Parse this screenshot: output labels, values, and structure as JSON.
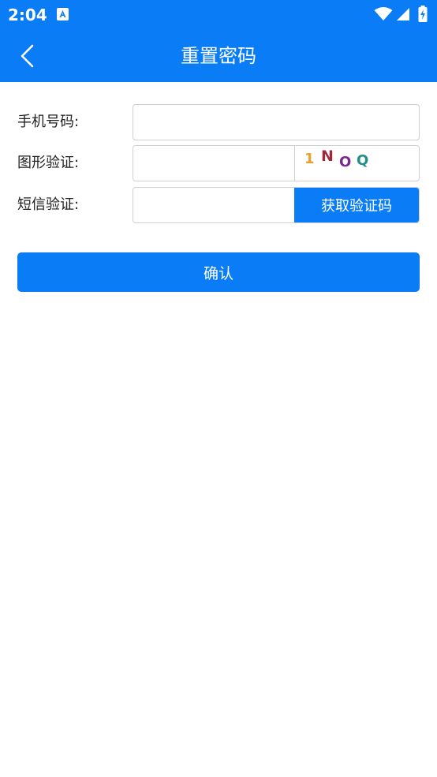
{
  "status_bar": {
    "time": "2:04",
    "icons": [
      "app-notification-icon",
      "wifi-icon",
      "signal-icon",
      "battery-icon"
    ]
  },
  "header": {
    "title": "重置密码",
    "back_icon": "chevron-left-icon"
  },
  "form": {
    "phone": {
      "label": "手机号码:",
      "value": "",
      "placeholder": ""
    },
    "captcha": {
      "label": "图形验证:",
      "value": "",
      "placeholder": "",
      "image_text": [
        "1",
        "N",
        "O",
        "Q"
      ]
    },
    "sms": {
      "label": "短信验证:",
      "value": "",
      "placeholder": "",
      "button_label": "获取验证码"
    }
  },
  "actions": {
    "confirm_label": "确认"
  },
  "colors": {
    "primary": "#0a7cf5",
    "captcha_chars": [
      "#e8a22b",
      "#a0283a",
      "#7a2a8c",
      "#1f8f8a"
    ]
  }
}
